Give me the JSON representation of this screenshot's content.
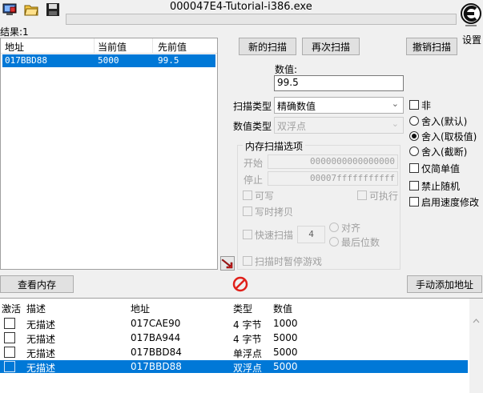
{
  "window": {
    "title": "000047E4-Tutorial-i386.exe"
  },
  "toolbar": {
    "open_process_icon": "monitor-icon",
    "open_file_icon": "folder-open-icon",
    "save_icon": "floppy-disk-icon"
  },
  "found_label": "结果:1",
  "results": {
    "columns": [
      "地址",
      "当前值",
      "先前值"
    ],
    "rows": [
      {
        "address": "017BBD88",
        "current": "5000",
        "previous": "99.5"
      }
    ]
  },
  "buttons": {
    "new_scan": "新的扫描",
    "next_scan": "再次扫描",
    "undo_scan": "撤销扫描",
    "settings": "设置",
    "view_memory": "查看内存",
    "add_manual": "手动添加地址"
  },
  "value": {
    "label": "数值:",
    "current": "99.5"
  },
  "scan_type": {
    "label": "扫描类型",
    "selected": "精确数值"
  },
  "value_type": {
    "label": "数值类型",
    "selected": "双浮点"
  },
  "mem_options": {
    "title": "内存扫描选项",
    "start_label": "开始",
    "start_value": "0000000000000000",
    "stop_label": "停止",
    "stop_value": "00007fffffffffff",
    "writable": "可写",
    "executable": "可执行",
    "copy_on_write": "写时拷贝",
    "fast_scan": "快速扫描",
    "fast_scan_value": "4",
    "align": "对齐",
    "last_digits": "最后位数",
    "pause_game": "扫描时暂停游戏"
  },
  "right_options": {
    "not": "非",
    "include_default": "舍入(默认)",
    "include_extreme": "舍入(取极值)",
    "include_truncate": "舍入(截断)",
    "simple_only": "仅简单值",
    "no_random": "禁止随机",
    "speedhack": "启用速度修改"
  },
  "address_list": {
    "columns": [
      "激活",
      "描述",
      "地址",
      "类型",
      "数值"
    ],
    "rows": [
      {
        "desc": "无描述",
        "address": "017CAE90",
        "type": "4 字节",
        "value": "1000"
      },
      {
        "desc": "无描述",
        "address": "017BA944",
        "type": "4 字节",
        "value": "5000"
      },
      {
        "desc": "无描述",
        "address": "017BBD84",
        "type": "单浮点",
        "value": "5000"
      },
      {
        "desc": "无描述",
        "address": "017BBD88",
        "type": "双浮点",
        "value": "5000"
      }
    ]
  },
  "colors": {
    "selection": "#0078d7",
    "stop_icon": "#e0201a",
    "arrow_icon": "#d02020"
  }
}
